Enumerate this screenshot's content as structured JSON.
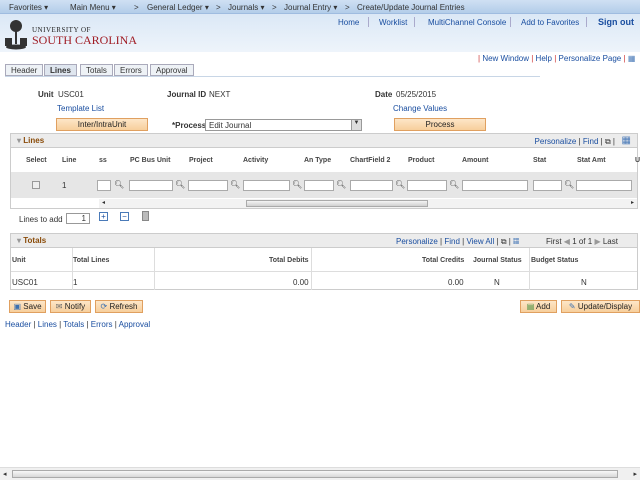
{
  "topnav": {
    "items": [
      "Favorites ▾",
      "Main Menu ▾",
      ">",
      "General Ledger ▾",
      ">",
      "Journals ▾",
      ">",
      "Journal Entry ▾",
      ">",
      "Create/Update Journal Entries"
    ]
  },
  "header": {
    "logo_line1": "UNIVERSITY OF",
    "logo_line2": "SOUTH CAROLINA",
    "links": [
      "Home",
      "Worklist",
      "MultiChannel Console",
      "Add to Favorites",
      "Sign out"
    ]
  },
  "utility": {
    "links": [
      "New Window",
      "Help",
      "Personalize Page"
    ]
  },
  "tabs": [
    {
      "label": "Header"
    },
    {
      "label": "Lines",
      "active": true
    },
    {
      "label": "Totals"
    },
    {
      "label": "Errors"
    },
    {
      "label": "Approval"
    }
  ],
  "form": {
    "unit_label": "Unit",
    "unit_value": "USC01",
    "journal_id_label": "Journal ID",
    "journal_id_value": "NEXT",
    "date_label": "Date",
    "date_value": "05/25/2015",
    "template_list": "Template List",
    "change_values": "Change Values",
    "inter_button": "Inter/IntraUnit",
    "process_label": "*Process",
    "process_value": "Edit Journal",
    "process_button": "Process"
  },
  "lines": {
    "title": "Lines",
    "toolbar": [
      "Personalize",
      "Find"
    ],
    "columns": [
      "Select",
      "Line",
      "ss",
      "PC Bus Unit",
      "Project",
      "Activity",
      "An Type",
      "ChartField 2",
      "Product",
      "Amount",
      "Stat",
      "Stat Amt",
      "U"
    ],
    "rows": [
      {
        "line": "1"
      }
    ],
    "lines_to_add_label": "Lines to add",
    "lines_to_add_value": "1"
  },
  "totals": {
    "title": "Totals",
    "toolbar": [
      "Personalize",
      "Find",
      "View All"
    ],
    "nav": {
      "first": "First",
      "range": "1 of 1",
      "last": "Last"
    },
    "columns": [
      "Unit",
      "Total Lines",
      "Total Debits",
      "Total Credits",
      "Journal Status",
      "Budget Status"
    ],
    "rows": [
      {
        "unit": "USC01",
        "total_lines": "1",
        "total_debits": "0.00",
        "total_credits": "0.00",
        "journal_status": "N",
        "budget_status": "N"
      }
    ]
  },
  "actions": {
    "save": "Save",
    "notify": "Notify",
    "refresh": "Refresh",
    "add": "Add",
    "update_display": "Update/Display"
  },
  "footer_links": [
    "Header",
    "Lines",
    "Totals",
    "Errors",
    "Approval"
  ]
}
